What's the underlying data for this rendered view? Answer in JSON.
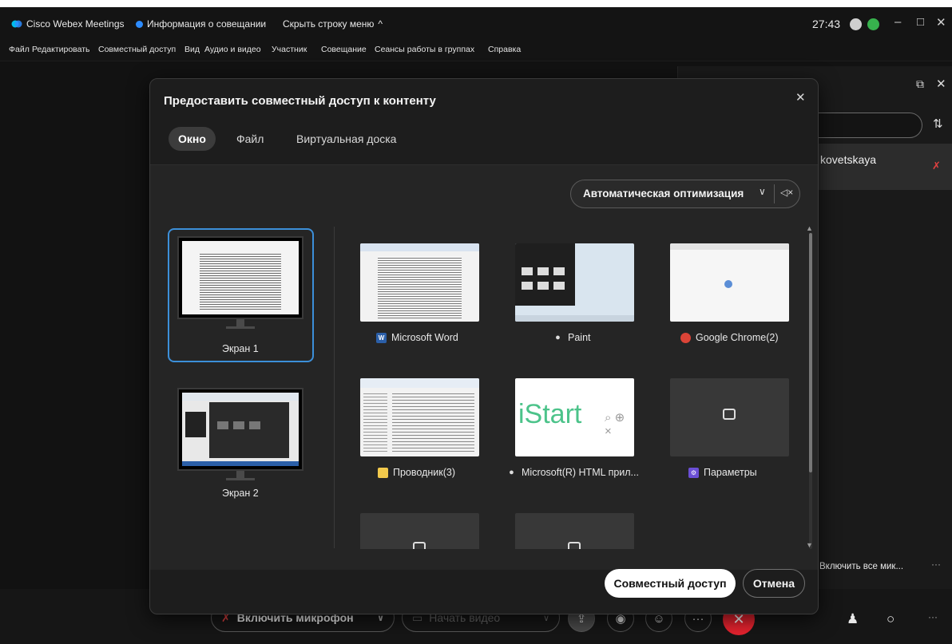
{
  "titlebar": {
    "app_name": "Cisco Webex Meetings",
    "meeting_info": "Информация о совещании",
    "hide_menu": "Скрыть строку меню",
    "hide_menu_chevron": "^",
    "time": "27:43",
    "minimize": "–",
    "maximize": "□",
    "close": "✕"
  },
  "menubar": {
    "items": [
      "Файл",
      "Редактировать",
      "Совместный доступ",
      "Вид",
      "Аудио и видео",
      "Участник",
      "Совещание",
      "Сеансы работы в группах",
      "Справка"
    ]
  },
  "modal": {
    "title": "Предоставить совместный доступ к контенту",
    "close": "✕",
    "tabs": [
      {
        "label": "Окно",
        "active": true
      },
      {
        "label": "Файл",
        "active": false
      },
      {
        "label": "Виртуальная доска",
        "active": false
      }
    ],
    "optimization": {
      "selected": "Автоматическая оптимизация",
      "chevron": "∨"
    },
    "screens": [
      {
        "label": "Экран 1",
        "selected": true
      },
      {
        "label": "Экран 2",
        "selected": false
      }
    ],
    "windows": [
      {
        "label": "Microsoft Word",
        "icon": "word-icon"
      },
      {
        "label": "Paint",
        "icon": "paint-icon"
      },
      {
        "label": "Google Chrome(2)",
        "icon": "chrome-icon"
      },
      {
        "label": "Проводник(3)",
        "icon": "explorer-icon"
      },
      {
        "label": "Microsoft(R) HTML прил...",
        "icon": "search-icon"
      },
      {
        "label": "Параметры",
        "icon": "settings-icon"
      }
    ],
    "istart_text": "iStart",
    "share_button": "Совместный доступ",
    "cancel_button": "Отмена"
  },
  "right_panel": {
    "participant_name": "kovetskaya",
    "mute_all": "Включить все мик...",
    "more": "···"
  },
  "bottombar": {
    "mic_button": "Включить микрофон",
    "video_button": "Начать видео",
    "more": "···"
  },
  "colors": {
    "accent_blue": "#3c8fd9",
    "end_red": "#e8232f",
    "mute_red": "#e04040"
  }
}
